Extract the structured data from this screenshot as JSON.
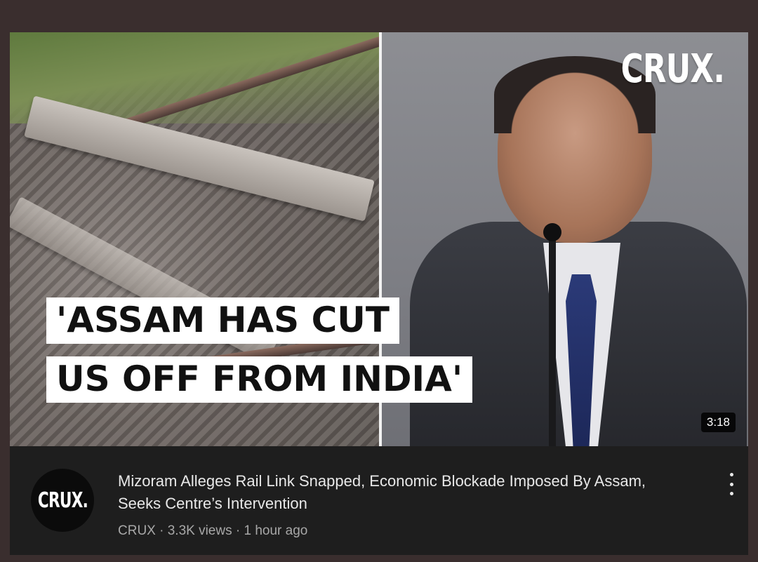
{
  "thumbnail": {
    "brand_logo": "CRUX.",
    "headline_line1": "'ASSAM HAS CUT",
    "headline_line2": "US OFF FROM INDIA'",
    "duration": "3:18"
  },
  "video": {
    "channel_avatar_text": "CRUX.",
    "title": "Mizoram Alleges Rail Link Snapped, Economic Blockade Imposed By Assam, Seeks Centre’s Intervention",
    "meta": "CRUX · 3.3K views · 1 hour ago",
    "more_icon": "vertical-dots-icon"
  },
  "colors": {
    "page_background": "#3a2e2e",
    "card_background": "#1e1e1e",
    "title_text": "#e8e8e8",
    "meta_text": "#a8a8a8"
  }
}
